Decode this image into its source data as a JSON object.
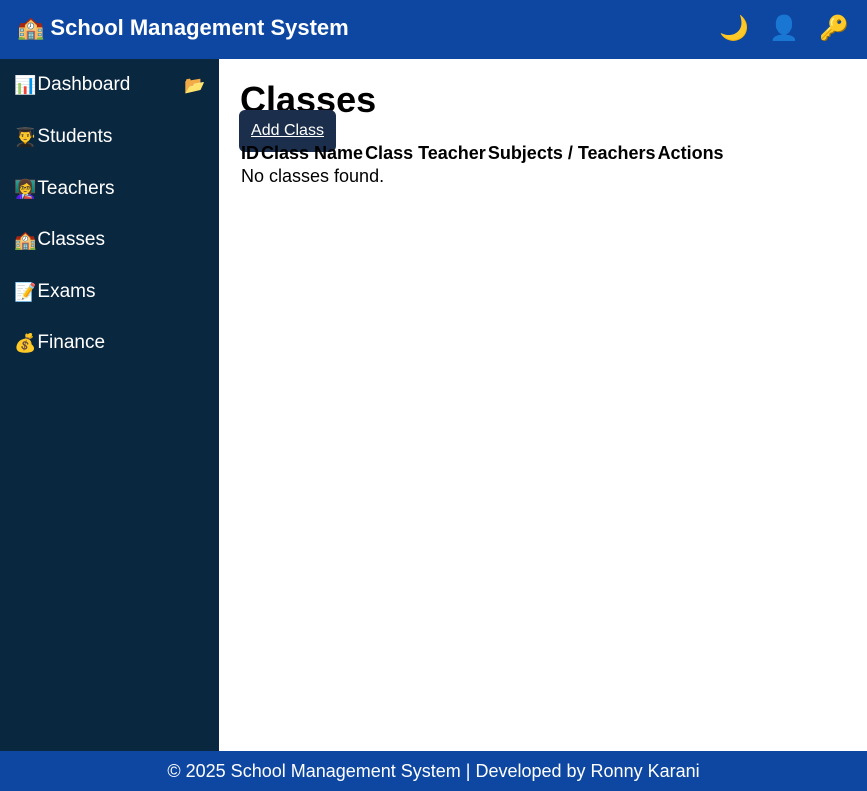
{
  "header": {
    "logo_icon": "🏫",
    "title": "School Management System",
    "icons": {
      "theme": "🌙",
      "profile": "👤",
      "login": "🔑"
    }
  },
  "sidebar": {
    "toggle_icon": "📂",
    "items": [
      {
        "icon": "📊",
        "label": "Dashboard"
      },
      {
        "icon": "👨‍🎓",
        "label": "Students"
      },
      {
        "icon": "👩‍🏫",
        "label": "Teachers"
      },
      {
        "icon": "🏫",
        "label": "Classes"
      },
      {
        "icon": "📝",
        "label": "Exams"
      },
      {
        "icon": "💰",
        "label": "Finance"
      }
    ]
  },
  "main": {
    "title": "Classes",
    "add_button": "Add Class",
    "table": {
      "columns": [
        "ID",
        "Class Name",
        "Class Teacher",
        "Subjects / Teachers",
        "Actions"
      ],
      "empty_message": "No classes found."
    }
  },
  "footer": {
    "text": "© 2025 School Management System | Developed by Ronny Karani"
  },
  "colors": {
    "header_bg": "#0d47a1",
    "sidebar_bg": "#0a2740",
    "button_bg": "#1b2f4d"
  }
}
